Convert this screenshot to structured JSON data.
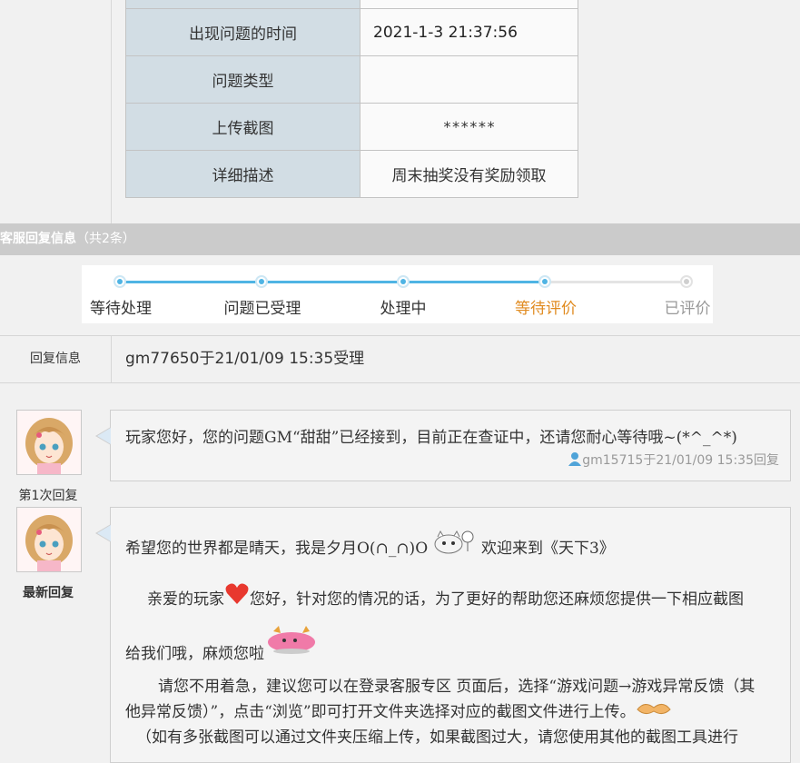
{
  "info_table": [
    {
      "label": "出现问题的时间",
      "value": "2021-1-3 21:37:56"
    },
    {
      "label": "问题类型",
      "value": ""
    },
    {
      "label": "上传截图",
      "value": "******"
    },
    {
      "label": "详细描述",
      "value": "周末抽奖没有奖励领取"
    }
  ],
  "section": {
    "title": "客服回复信息",
    "count": "（共2条）"
  },
  "progress": {
    "steps": [
      {
        "label": "等待处理",
        "state": "done"
      },
      {
        "label": "问题已受理",
        "state": "done"
      },
      {
        "label": "处理中",
        "state": "done"
      },
      {
        "label": "等待评价",
        "state": "current"
      },
      {
        "label": "已评价",
        "state": "todo"
      }
    ],
    "colors": {
      "done": "#4fb4e4",
      "current_text": "#e08a1e",
      "todo_text": "#999999"
    }
  },
  "reply_info": {
    "label": "回复信息",
    "agent": "gm77650",
    "connector": "于",
    "datetime": "21/01/09 15:35",
    "suffix": "受理"
  },
  "replies": [
    {
      "label": "第1次回复",
      "text": "玩家您好，您的问题GM“甜甜”已经接到，目前正在查证中，还请您耐心等待哦~(*^_^*)",
      "author": "gm15715",
      "connector": "于",
      "datetime": "21/01/09 15:35",
      "suffix": "回复",
      "author_icon": "user-icon"
    },
    {
      "label": "最新回复",
      "greeting_a": "希望您的世界都是晴天，我是夕月O(∩_∩)O",
      "greeting_b": "欢迎来到《天下3》",
      "para1_a": "亲爱的玩家",
      "para1_b": "您好，针对您的情况的话，为了更好的帮助您还麻烦您提供一下相应截图",
      "para1_c": "给我们哦，麻烦您啦",
      "para2_a": "请您不用着急，建议您可以在登录客服专区 页面后，选择“游戏问题→游戏异常反馈（其",
      "para2_b": "他异常反馈）”，点击“浏览”即可打开文件夹选择对应的截图文件进行上传。",
      "para3": "（如有多张截图可以通过文件夹压缩上传，如果截图过大，请您使用其他的截图工具进行",
      "emoticons": [
        "cat-emoticon",
        "heart-emoticon",
        "pink-creature-emoticon",
        "handshake-emoticon"
      ]
    }
  ]
}
